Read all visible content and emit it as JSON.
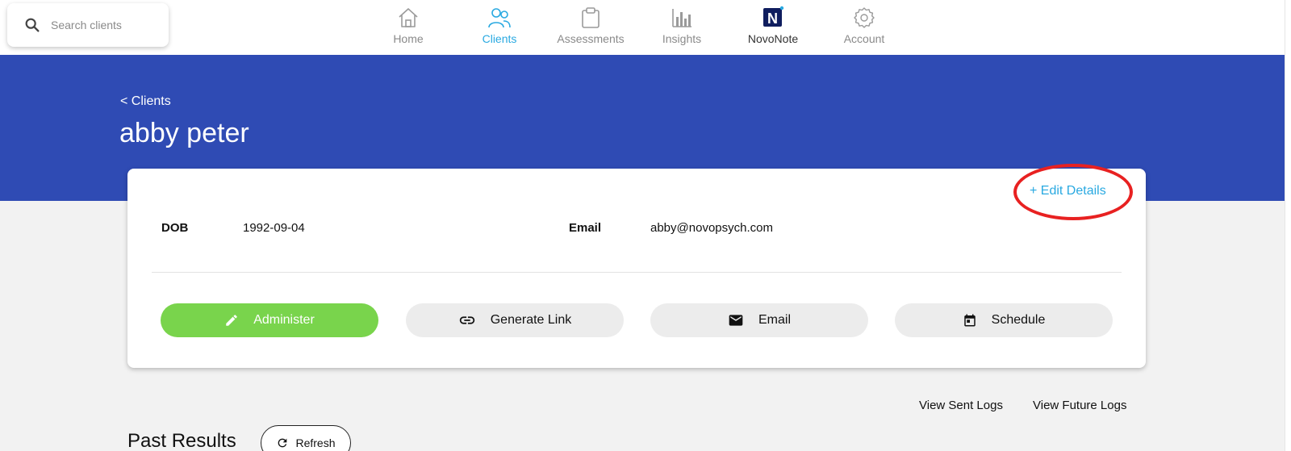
{
  "search": {
    "placeholder": "Search clients",
    "icon": "search-icon"
  },
  "nav": {
    "items": [
      {
        "label": "Home",
        "icon": "home-icon"
      },
      {
        "label": "Clients",
        "icon": "people-icon"
      },
      {
        "label": "Assessments",
        "icon": "clipboard-icon"
      },
      {
        "label": "Insights",
        "icon": "bar-chart-icon"
      },
      {
        "label": "NovoNote",
        "icon": "novonote-logo-icon"
      },
      {
        "label": "Account",
        "icon": "gear-icon"
      }
    ],
    "active": "Clients",
    "novonote_letter": "N"
  },
  "header": {
    "breadcrumb": "< Clients",
    "client_name": "abby peter"
  },
  "card": {
    "edit_label": "+ Edit Details",
    "dob_label": "DOB",
    "dob_value": "1992-09-04",
    "email_label": "Email",
    "email_value": "abby@novopsych.com",
    "actions": [
      {
        "label": "Administer",
        "icon": "pencil-icon"
      },
      {
        "label": "Generate Link",
        "icon": "link-icon"
      },
      {
        "label": "Email",
        "icon": "mail-icon"
      },
      {
        "label": "Schedule",
        "icon": "calendar-icon"
      }
    ]
  },
  "logs": {
    "sent_label": "View Sent Logs",
    "future_label": "View Future Logs"
  },
  "past_results": {
    "title": "Past Results",
    "refresh_label": "Refresh"
  },
  "colors": {
    "banner": "#2f4bb4",
    "accent": "#29a9e1",
    "primary_button": "#79d44c",
    "annotation": "#e82121"
  }
}
